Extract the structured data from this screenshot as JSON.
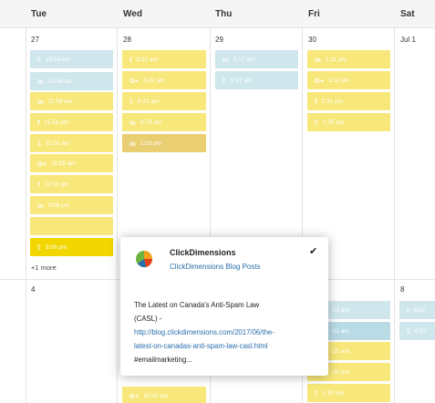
{
  "header": {
    "days": [
      "Tue",
      "Wed",
      "Thu",
      "Fri",
      "Sat"
    ]
  },
  "week1": {
    "dates": [
      "27",
      "28",
      "29",
      "30",
      "Jul 1"
    ],
    "tue": [
      {
        "icon": "𝕥",
        "name": "twitter-icon",
        "label": "10:54 am",
        "style": "b"
      },
      {
        "icon": "in",
        "name": "linkedin-icon",
        "label": "10:54 am",
        "style": "b"
      },
      {
        "icon": "in",
        "name": "linkedin-icon",
        "label": "11:58 am",
        "style": "y"
      },
      {
        "icon": "f",
        "name": "facebook-icon",
        "label": "11:58 am",
        "style": "y"
      },
      {
        "icon": "𝕥",
        "name": "twitter-icon",
        "label": "11:59 am",
        "style": "y"
      },
      {
        "icon": "G+",
        "name": "googleplus-icon",
        "label": "11:59 am",
        "style": "y"
      },
      {
        "icon": "f",
        "name": "facebook-icon",
        "label": "12:03 pm",
        "style": "y"
      },
      {
        "icon": "in",
        "name": "linkedin-icon",
        "label": "3:08 pm",
        "style": "y"
      },
      {
        "icon": "𝕥",
        "name": "twitter-icon",
        "label": "3:09 pm",
        "style": "sel"
      }
    ],
    "wed": [
      {
        "icon": "f",
        "name": "facebook-icon",
        "label": "9:22 am",
        "style": "y"
      },
      {
        "icon": "G+",
        "name": "googleplus-icon",
        "label": "9:22 am",
        "style": "y"
      },
      {
        "icon": "𝕥",
        "name": "twitter-icon",
        "label": "9:23 am",
        "style": "y"
      },
      {
        "icon": "in",
        "name": "linkedin-icon",
        "label": "9:23 am",
        "style": "y"
      },
      {
        "icon": "in",
        "name": "linkedin-icon",
        "label": "1:53 pm",
        "style": "dk"
      }
    ],
    "thu": [
      {
        "icon": "in",
        "name": "linkedin-icon",
        "label": "9:17 am",
        "style": "b"
      },
      {
        "icon": "𝕥",
        "name": "twitter-icon",
        "label": "9:17 am",
        "style": "b"
      }
    ],
    "fri": [
      {
        "icon": "in",
        "name": "linkedin-icon",
        "label": "1:31 pm",
        "style": "y"
      },
      {
        "icon": "G+",
        "name": "googleplus-icon",
        "label": "1:31 pm",
        "style": "y"
      },
      {
        "icon": "f",
        "name": "facebook-icon",
        "label": "1:31 pm",
        "style": "y"
      },
      {
        "icon": "𝕥",
        "name": "twitter-icon",
        "label": "1:35 pm",
        "style": "y"
      }
    ],
    "more": "+1 more"
  },
  "week2": {
    "dates": [
      "4",
      "8"
    ],
    "fri": [
      {
        "icon": "",
        "name": "event-icon",
        "label": ":01 am",
        "style": "b"
      },
      {
        "icon": "",
        "name": "event-icon",
        "label": ":01 am",
        "style": "bl"
      },
      {
        "icon": "",
        "name": "event-icon",
        "label": ":25 am",
        "style": "y"
      },
      {
        "icon": "",
        "name": "event-icon",
        "label": ":25 am",
        "style": "y"
      },
      {
        "icon": "𝕥",
        "name": "twitter-icon",
        "label": "1:30 pm",
        "style": "y"
      }
    ],
    "wed": [
      {
        "icon": "G+",
        "name": "googleplus-icon",
        "label": "10:20 am",
        "style": "y"
      }
    ],
    "sat": [
      {
        "icon": "f",
        "name": "facebook-icon",
        "label": "6:52",
        "style": "b"
      },
      {
        "icon": "𝕥",
        "name": "twitter-icon",
        "label": "6:52",
        "style": "b"
      }
    ]
  },
  "popup": {
    "name": "ClickDimensions",
    "subtitle": "ClickDimensions Blog Posts",
    "text_line1": "The Latest on Canada's Anti-Spam Law",
    "text_line2": "(CASL) -",
    "link_line1": "http://blog.clickdimensions.com/2017/06/the-",
    "link_line2": "latest-on-canadas-anti-spam-law-casl.html",
    "text_line3": "#emailmarketing..."
  },
  "colors": {
    "approved_yellow": "#f8e77a",
    "pending_blue": "#cfe7ec",
    "selected": "#f1d600",
    "link": "#2a6fad"
  }
}
